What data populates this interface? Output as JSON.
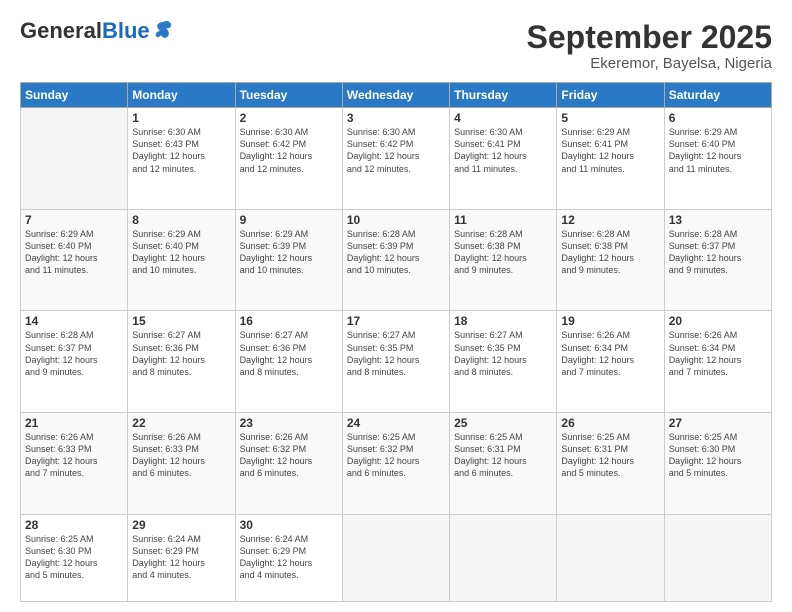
{
  "header": {
    "logo_general": "General",
    "logo_blue": "Blue",
    "month_title": "September 2025",
    "location": "Ekeremor, Bayelsa, Nigeria"
  },
  "days_of_week": [
    "Sunday",
    "Monday",
    "Tuesday",
    "Wednesday",
    "Thursday",
    "Friday",
    "Saturday"
  ],
  "weeks": [
    [
      {
        "day": "",
        "detail": ""
      },
      {
        "day": "1",
        "detail": "Sunrise: 6:30 AM\nSunset: 6:43 PM\nDaylight: 12 hours\nand 12 minutes."
      },
      {
        "day": "2",
        "detail": "Sunrise: 6:30 AM\nSunset: 6:42 PM\nDaylight: 12 hours\nand 12 minutes."
      },
      {
        "day": "3",
        "detail": "Sunrise: 6:30 AM\nSunset: 6:42 PM\nDaylight: 12 hours\nand 12 minutes."
      },
      {
        "day": "4",
        "detail": "Sunrise: 6:30 AM\nSunset: 6:41 PM\nDaylight: 12 hours\nand 11 minutes."
      },
      {
        "day": "5",
        "detail": "Sunrise: 6:29 AM\nSunset: 6:41 PM\nDaylight: 12 hours\nand 11 minutes."
      },
      {
        "day": "6",
        "detail": "Sunrise: 6:29 AM\nSunset: 6:40 PM\nDaylight: 12 hours\nand 11 minutes."
      }
    ],
    [
      {
        "day": "7",
        "detail": "Sunrise: 6:29 AM\nSunset: 6:40 PM\nDaylight: 12 hours\nand 11 minutes."
      },
      {
        "day": "8",
        "detail": "Sunrise: 6:29 AM\nSunset: 6:40 PM\nDaylight: 12 hours\nand 10 minutes."
      },
      {
        "day": "9",
        "detail": "Sunrise: 6:29 AM\nSunset: 6:39 PM\nDaylight: 12 hours\nand 10 minutes."
      },
      {
        "day": "10",
        "detail": "Sunrise: 6:28 AM\nSunset: 6:39 PM\nDaylight: 12 hours\nand 10 minutes."
      },
      {
        "day": "11",
        "detail": "Sunrise: 6:28 AM\nSunset: 6:38 PM\nDaylight: 12 hours\nand 9 minutes."
      },
      {
        "day": "12",
        "detail": "Sunrise: 6:28 AM\nSunset: 6:38 PM\nDaylight: 12 hours\nand 9 minutes."
      },
      {
        "day": "13",
        "detail": "Sunrise: 6:28 AM\nSunset: 6:37 PM\nDaylight: 12 hours\nand 9 minutes."
      }
    ],
    [
      {
        "day": "14",
        "detail": "Sunrise: 6:28 AM\nSunset: 6:37 PM\nDaylight: 12 hours\nand 9 minutes."
      },
      {
        "day": "15",
        "detail": "Sunrise: 6:27 AM\nSunset: 6:36 PM\nDaylight: 12 hours\nand 8 minutes."
      },
      {
        "day": "16",
        "detail": "Sunrise: 6:27 AM\nSunset: 6:36 PM\nDaylight: 12 hours\nand 8 minutes."
      },
      {
        "day": "17",
        "detail": "Sunrise: 6:27 AM\nSunset: 6:35 PM\nDaylight: 12 hours\nand 8 minutes."
      },
      {
        "day": "18",
        "detail": "Sunrise: 6:27 AM\nSunset: 6:35 PM\nDaylight: 12 hours\nand 8 minutes."
      },
      {
        "day": "19",
        "detail": "Sunrise: 6:26 AM\nSunset: 6:34 PM\nDaylight: 12 hours\nand 7 minutes."
      },
      {
        "day": "20",
        "detail": "Sunrise: 6:26 AM\nSunset: 6:34 PM\nDaylight: 12 hours\nand 7 minutes."
      }
    ],
    [
      {
        "day": "21",
        "detail": "Sunrise: 6:26 AM\nSunset: 6:33 PM\nDaylight: 12 hours\nand 7 minutes."
      },
      {
        "day": "22",
        "detail": "Sunrise: 6:26 AM\nSunset: 6:33 PM\nDaylight: 12 hours\nand 6 minutes."
      },
      {
        "day": "23",
        "detail": "Sunrise: 6:26 AM\nSunset: 6:32 PM\nDaylight: 12 hours\nand 6 minutes."
      },
      {
        "day": "24",
        "detail": "Sunrise: 6:25 AM\nSunset: 6:32 PM\nDaylight: 12 hours\nand 6 minutes."
      },
      {
        "day": "25",
        "detail": "Sunrise: 6:25 AM\nSunset: 6:31 PM\nDaylight: 12 hours\nand 6 minutes."
      },
      {
        "day": "26",
        "detail": "Sunrise: 6:25 AM\nSunset: 6:31 PM\nDaylight: 12 hours\nand 5 minutes."
      },
      {
        "day": "27",
        "detail": "Sunrise: 6:25 AM\nSunset: 6:30 PM\nDaylight: 12 hours\nand 5 minutes."
      }
    ],
    [
      {
        "day": "28",
        "detail": "Sunrise: 6:25 AM\nSunset: 6:30 PM\nDaylight: 12 hours\nand 5 minutes."
      },
      {
        "day": "29",
        "detail": "Sunrise: 6:24 AM\nSunset: 6:29 PM\nDaylight: 12 hours\nand 4 minutes."
      },
      {
        "day": "30",
        "detail": "Sunrise: 6:24 AM\nSunset: 6:29 PM\nDaylight: 12 hours\nand 4 minutes."
      },
      {
        "day": "",
        "detail": ""
      },
      {
        "day": "",
        "detail": ""
      },
      {
        "day": "",
        "detail": ""
      },
      {
        "day": "",
        "detail": ""
      }
    ]
  ]
}
